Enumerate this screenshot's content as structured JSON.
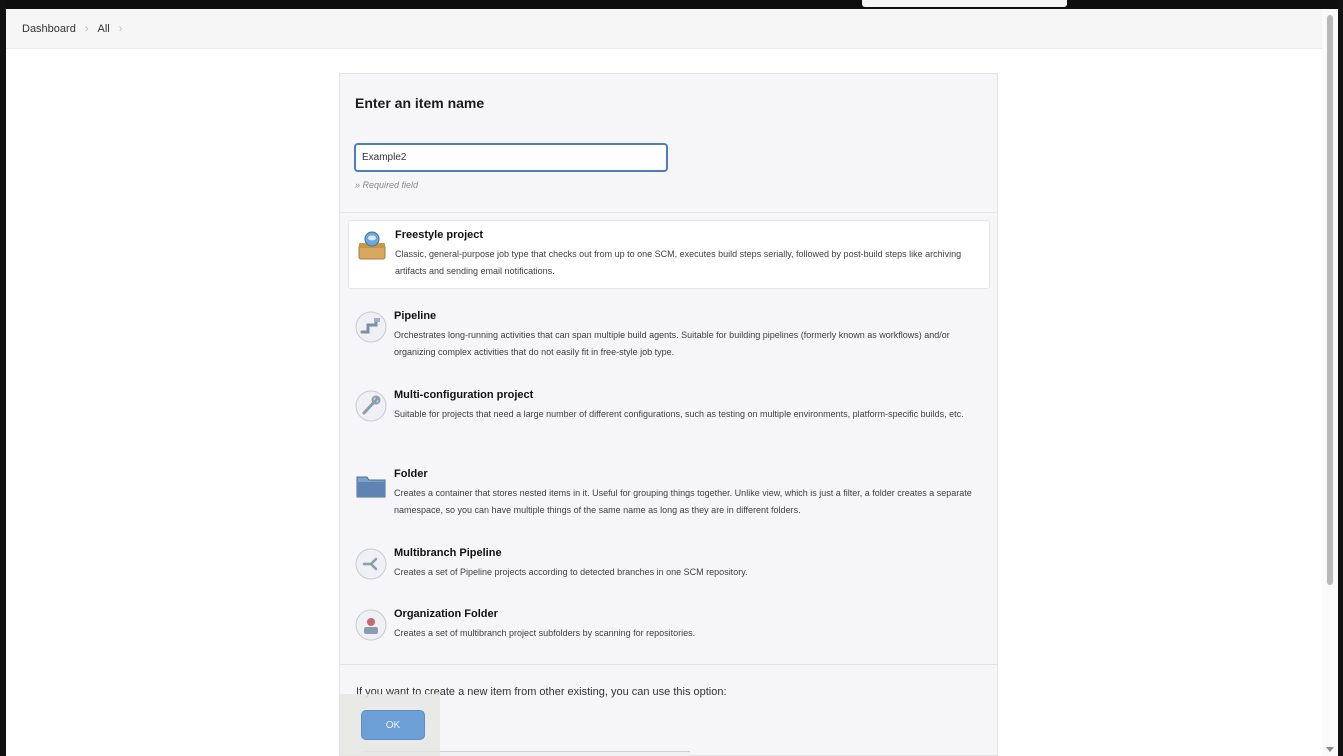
{
  "breadcrumb": {
    "items": [
      {
        "label": "Dashboard"
      },
      {
        "label": "All"
      }
    ]
  },
  "form": {
    "title": "Enter an item name",
    "item_name_value": "Example2",
    "required_note": "» Required field"
  },
  "item_types": [
    {
      "label": "Freestyle project",
      "description": "Classic, general-purpose job type that checks out from up to one SCM, executes build steps serially, followed by post-build steps like archiving artifacts and sending email notifications.",
      "icon": "freestyle-project-icon",
      "selected": true
    },
    {
      "label": "Pipeline",
      "description": "Orchestrates long-running activities that can span multiple build agents. Suitable for building pipelines (formerly known as workflows) and/or organizing complex activities that do not easily fit in free-style job type.",
      "icon": "pipeline-icon",
      "selected": false
    },
    {
      "label": "Multi-configuration project",
      "description": "Suitable for projects that need a large number of different configurations, such as testing on multiple environments, platform-specific builds, etc.",
      "icon": "multi-configuration-icon",
      "selected": false
    },
    {
      "label": "Folder",
      "description": "Creates a container that stores nested items in it. Useful for grouping things together. Unlike view, which is just a filter, a folder creates a separate namespace, so you can have multiple things of the same name as long as they are in different folders.",
      "icon": "folder-icon",
      "selected": false
    },
    {
      "label": "Multibranch Pipeline",
      "description": "Creates a set of Pipeline projects according to detected branches in one SCM repository.",
      "icon": "multibranch-pipeline-icon",
      "selected": false
    },
    {
      "label": "Organization Folder",
      "description": "Creates a set of multibranch project subfolders by scanning for repositories.",
      "icon": "organization-folder-icon",
      "selected": false
    }
  ],
  "copy_from": {
    "text": "If you want to create a new item from other existing, you can use this option:"
  },
  "actions": {
    "ok_label": "OK"
  },
  "colors": {
    "accent": "#4c7dc0",
    "ok_button": "#6c9fd6",
    "panel_bg": "#f6f6f8"
  }
}
